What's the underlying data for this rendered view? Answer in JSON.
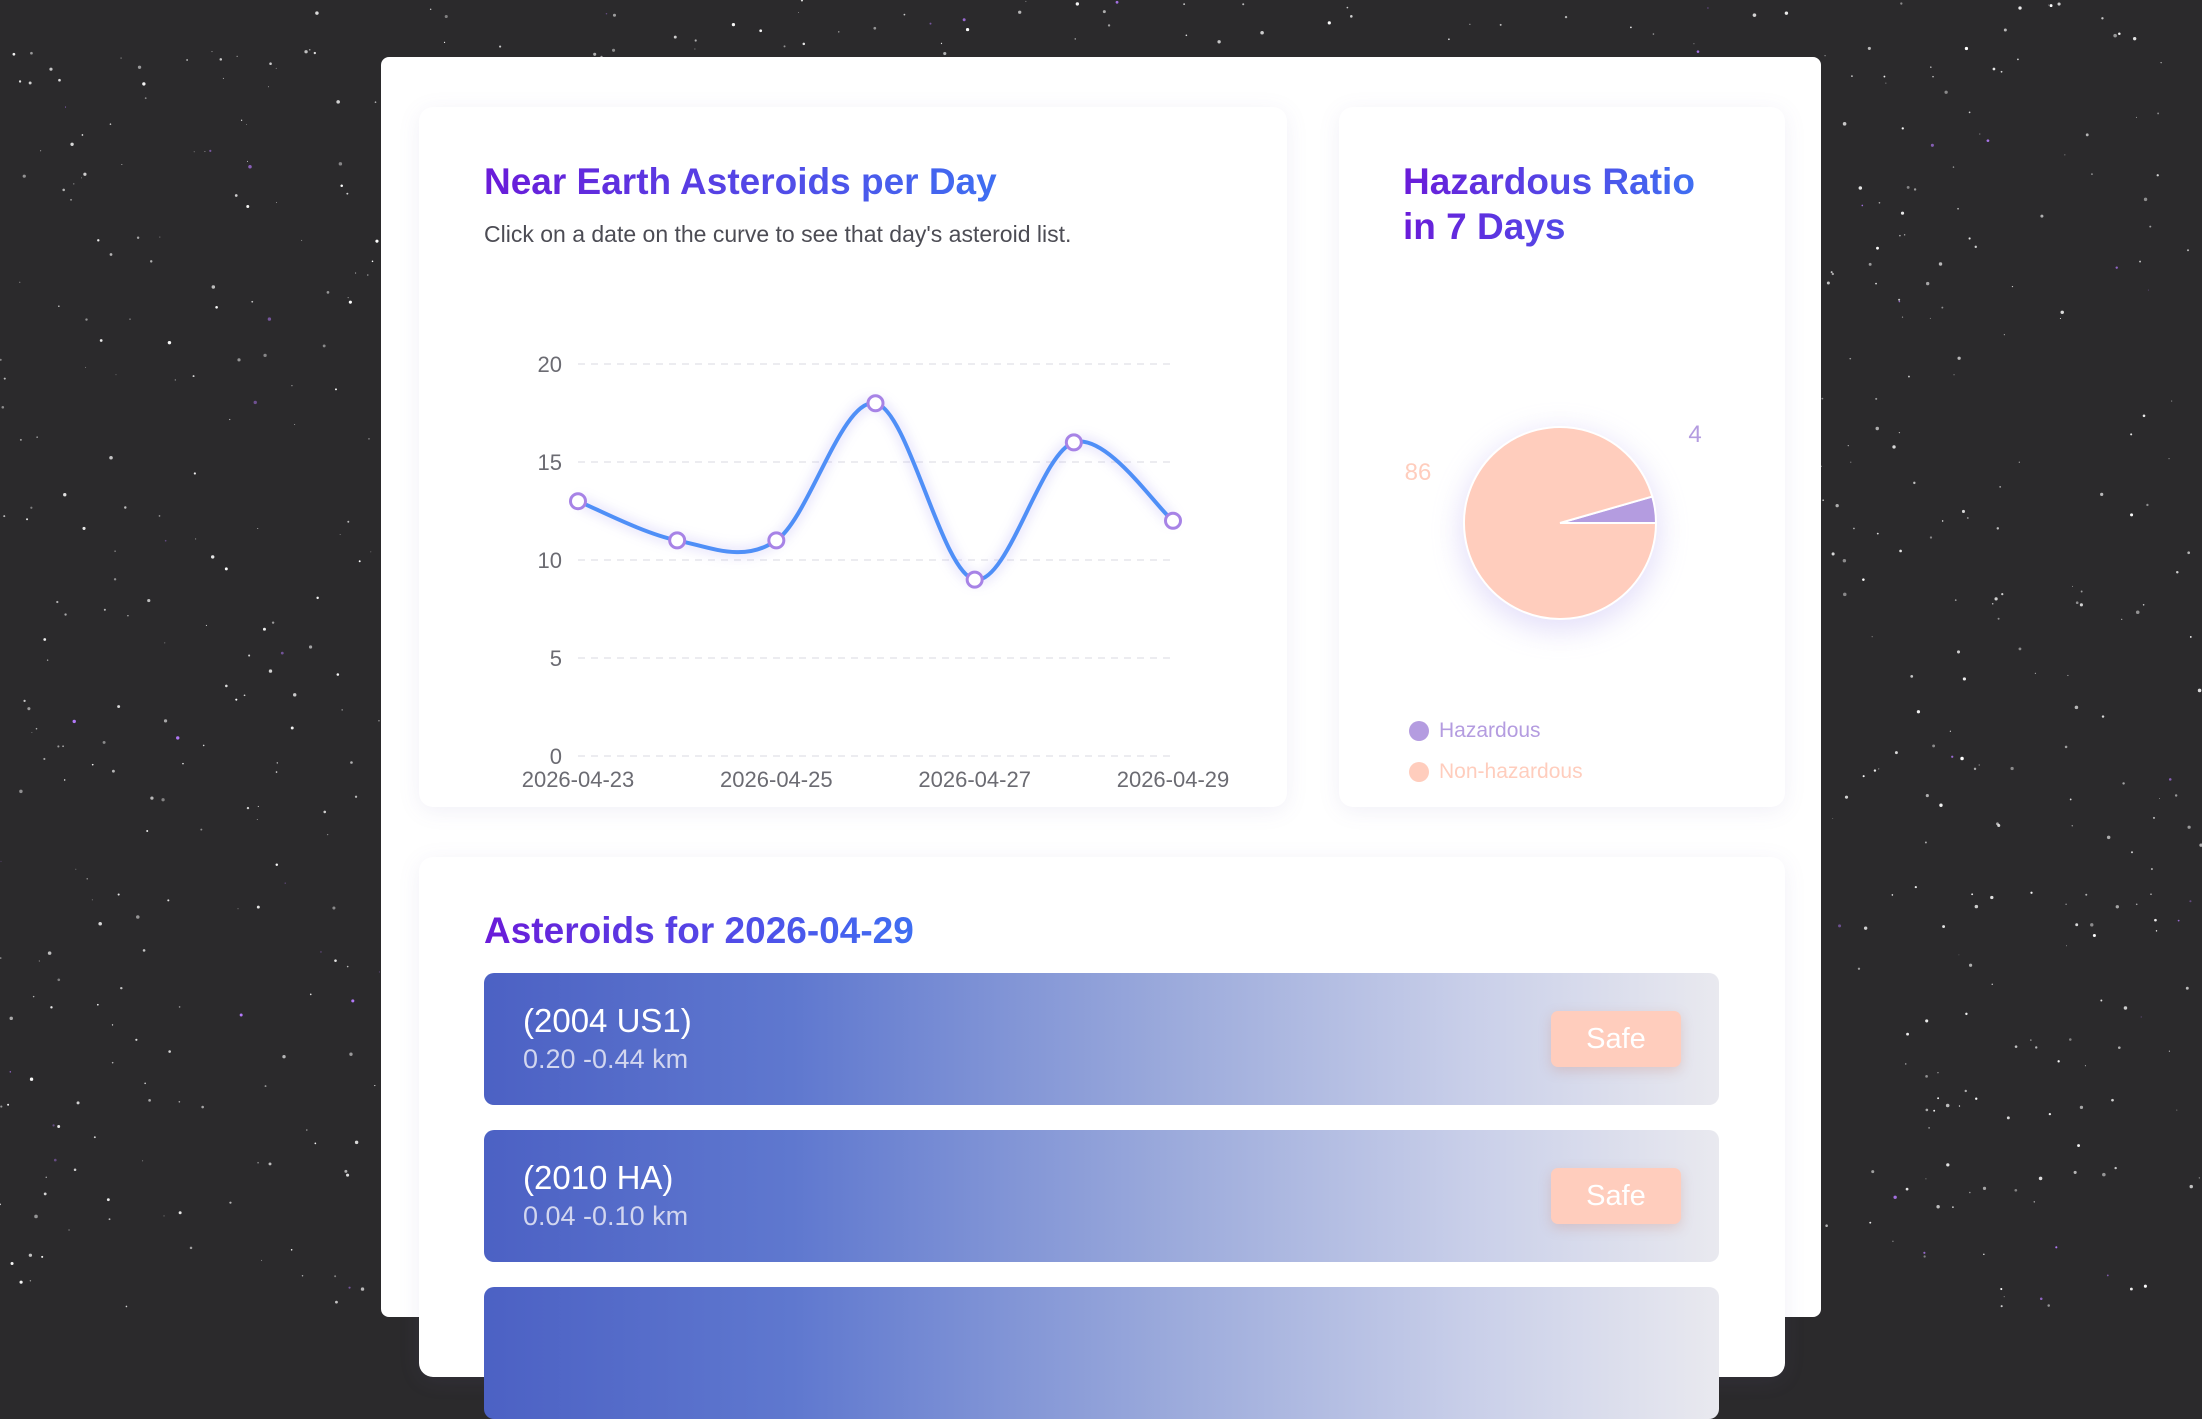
{
  "line_card": {
    "title": "Near Earth Asteroids per Day",
    "subtitle": "Click on a date on the curve to see that day's asteroid list."
  },
  "pie_card": {
    "title_line1": "Hazardous Ratio",
    "title_line2": "in 7 Days"
  },
  "list_card": {
    "title": "Asteroids for 2026-04-29",
    "asteroids": [
      {
        "name": "(2004 US1)",
        "size": "0.20 -0.44 km",
        "status": "Safe"
      },
      {
        "name": "(2010 HA)",
        "size": "0.04 -0.10 km",
        "status": "Safe"
      },
      {
        "name": "",
        "size": "",
        "status": ""
      }
    ]
  },
  "colors": {
    "line": "#4f8ff7",
    "hazardous": "#b49ce0",
    "non_hazardous": "#ffcdbd",
    "title_gradient_start": "#6a1bd9",
    "title_gradient_end": "#3f6ff2"
  },
  "chart_data": [
    {
      "type": "line",
      "x": [
        "2026-04-23",
        "2026-04-24",
        "2026-04-25",
        "2026-04-26",
        "2026-04-27",
        "2026-04-28",
        "2026-04-29"
      ],
      "y": [
        13,
        11,
        11,
        18,
        9,
        16,
        12
      ],
      "x_tick_labels": [
        "2026-04-23",
        "2026-04-25",
        "2026-04-27",
        "2026-04-29"
      ],
      "y_ticks": [
        0,
        5,
        10,
        15,
        20
      ],
      "ylim": [
        0,
        20
      ],
      "smooth": true,
      "grid": "horizontal dashed"
    },
    {
      "type": "pie",
      "labels": [
        "Hazardous",
        "Non-hazardous"
      ],
      "values": [
        4,
        86
      ],
      "legend": "bottom-left"
    }
  ]
}
